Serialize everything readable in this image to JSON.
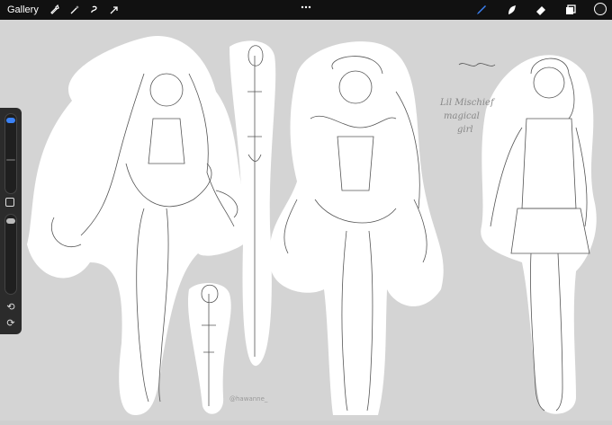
{
  "toolbar": {
    "gallery_label": "Gallery",
    "left_tools": [
      "wrench-icon",
      "magic-wand-icon",
      "selection-icon",
      "transform-arrow-icon"
    ],
    "right_tools": [
      "brush-icon",
      "smudge-icon",
      "eraser-icon",
      "layers-icon"
    ],
    "accent_color": "#3b82f6",
    "current_color": "#1b1b1b"
  },
  "canvas": {
    "handwritten_note": "Lil Mischief magical girl",
    "signature": "@hawanne_",
    "background_color": "#d4d4d4"
  },
  "sidebar": {
    "controls": [
      "brush-size-slider",
      "modify-button",
      "opacity-slider",
      "undo-button",
      "redo-button"
    ]
  }
}
